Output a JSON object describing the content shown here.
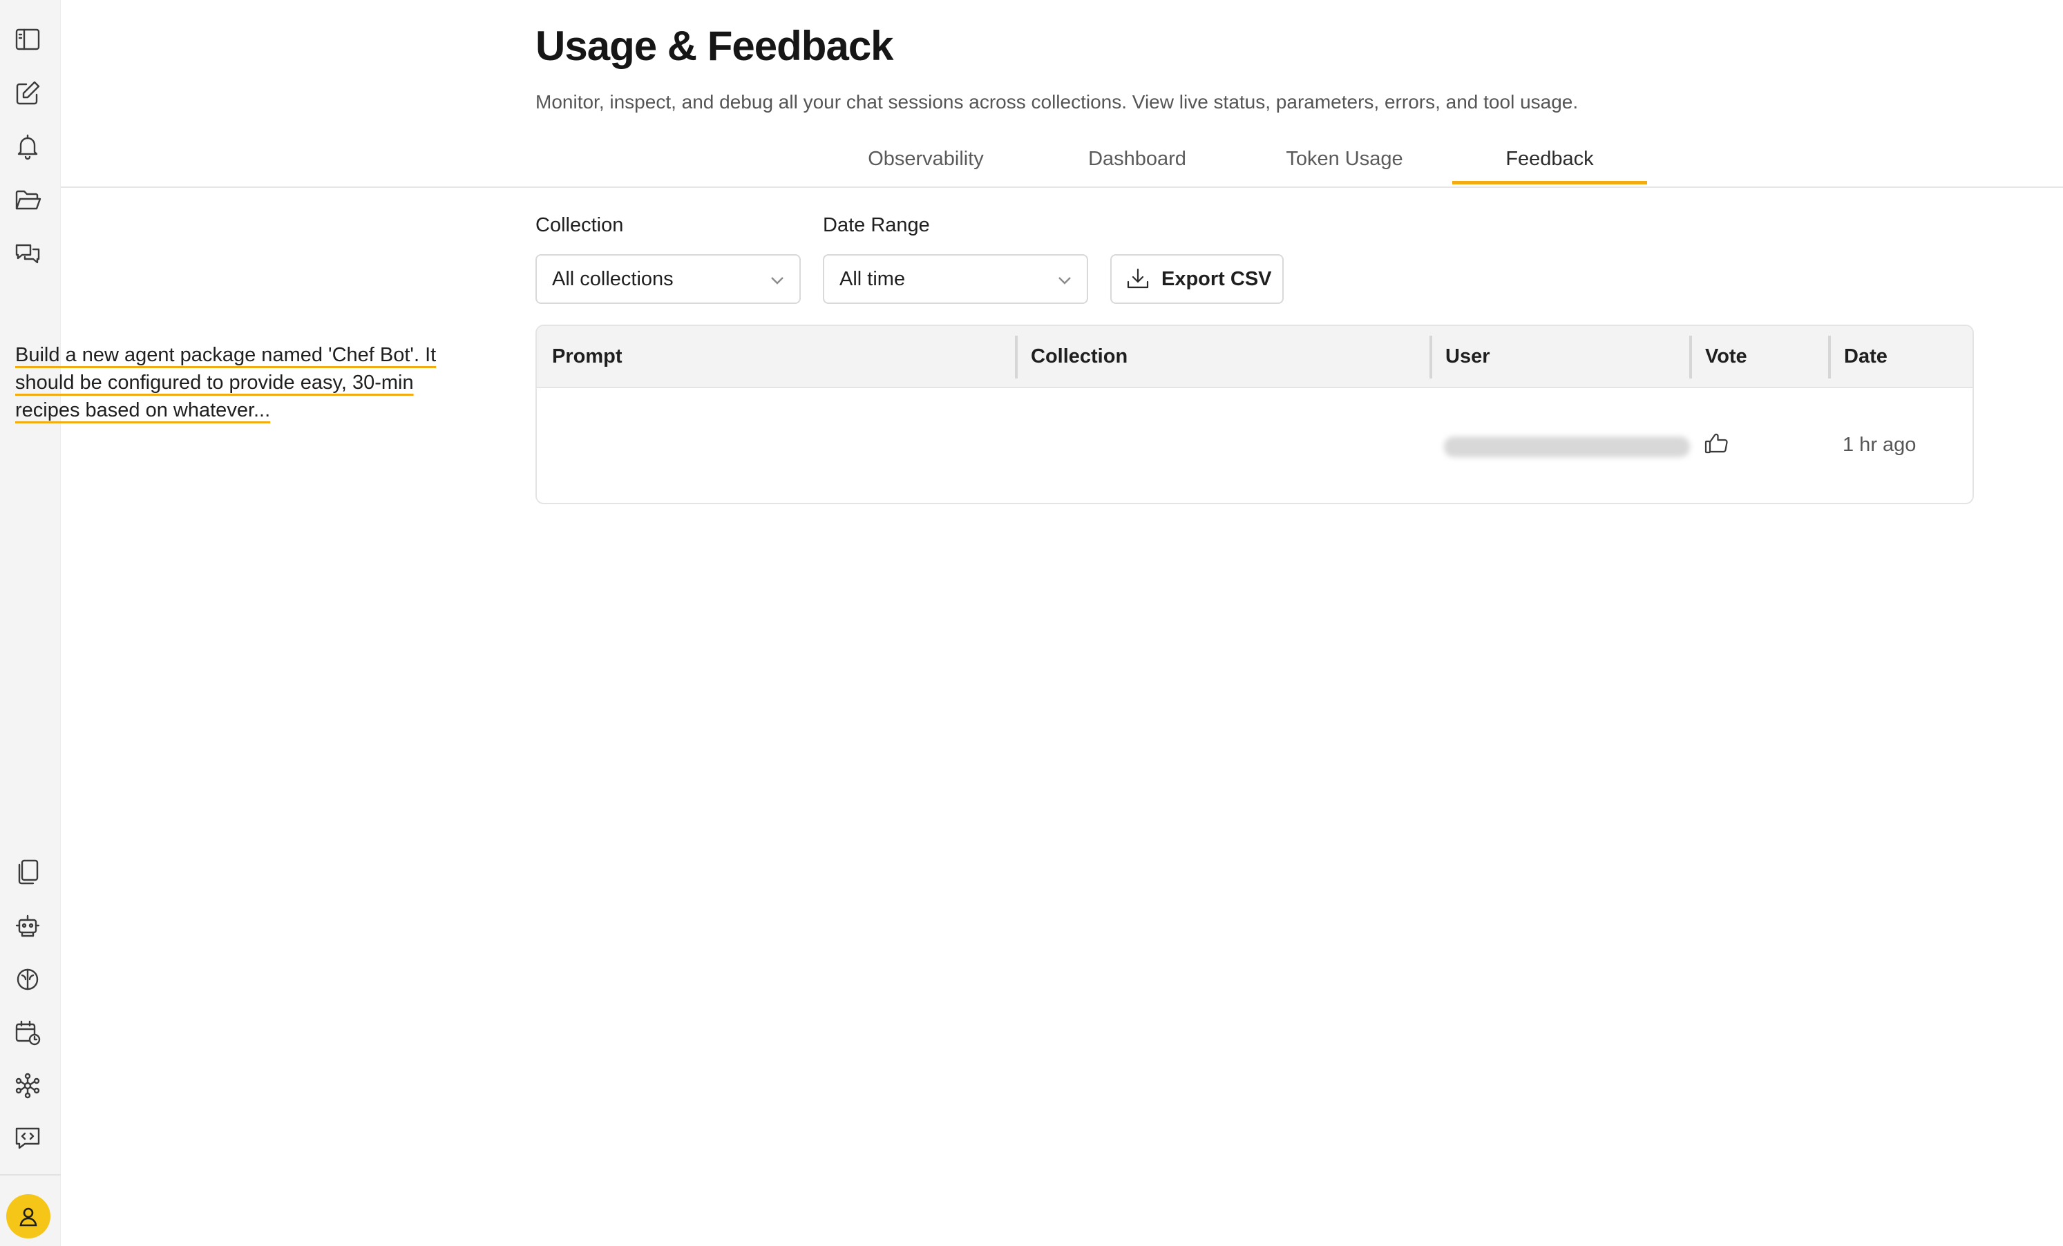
{
  "sidebar": {
    "top_icons": [
      "sidebar-toggle-icon",
      "compose-icon",
      "bell-icon",
      "folder-open-icon",
      "chat-bubbles-icon"
    ],
    "bottom_icons": [
      "documents-icon",
      "robot-icon",
      "brain-icon",
      "calendar-clock-icon",
      "network-icon",
      "code-chat-icon"
    ],
    "avatar_icon": "user-icon",
    "avatar_color": "#f5c518"
  },
  "header": {
    "title": "Usage & Feedback",
    "subtitle": "Monitor, inspect, and debug all your chat sessions across collections. View live status, parameters, errors, and tool usage."
  },
  "tabs": [
    {
      "label": "Observability",
      "active": false
    },
    {
      "label": "Dashboard",
      "active": false
    },
    {
      "label": "Token Usage",
      "active": false
    },
    {
      "label": "Feedback",
      "active": true
    }
  ],
  "accent_color": "#f2ab10",
  "filters": {
    "collection": {
      "label": "Collection",
      "value": "All collections"
    },
    "date_range": {
      "label": "Date Range",
      "value": "All time"
    },
    "export_label": "Export CSV"
  },
  "table": {
    "columns": [
      "Prompt",
      "Collection",
      "User",
      "Vote",
      "Date"
    ],
    "rows": [
      {
        "prompt_lines": [
          "Build a new agent package named 'Chef Bot'. It",
          "should be configured to provide easy, 30-min",
          "recipes based on whatever..."
        ],
        "collection": "",
        "vote_icon": "thumbs-up-icon",
        "date": "1 hr ago"
      }
    ]
  }
}
